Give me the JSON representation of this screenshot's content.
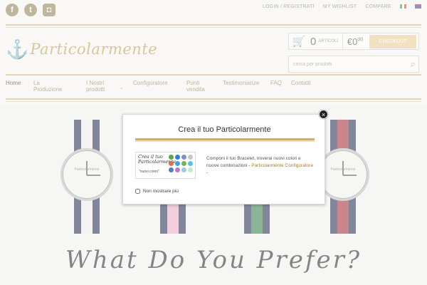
{
  "topbar": {
    "social": [
      {
        "name": "facebook-icon",
        "glyph": "f"
      },
      {
        "name": "tumblr-icon",
        "glyph": "t"
      },
      {
        "name": "instagram-icon",
        "glyph": "◘"
      }
    ],
    "links": [
      "LOGIN / REGISTRATI",
      "MY WISHLIST",
      "COMPARE"
    ],
    "languages": [
      "italian-flag-icon",
      "english-flag-icon"
    ]
  },
  "logo": {
    "text": "Particolarmente",
    "icon": "anchor-icon"
  },
  "cart": {
    "icon": "cart-icon",
    "count": "0",
    "count_label": "ARTICOLI",
    "price_currency": "€",
    "price_int": "0",
    "price_dec": "00",
    "checkout_label": "CHECKOUT"
  },
  "search": {
    "placeholder": "cerca per prodotti",
    "icon": "search-icon"
  },
  "nav": {
    "items": [
      {
        "label": "Home",
        "active": true
      },
      {
        "label": "La Produzione"
      },
      {
        "label": "I Nostri prodotti",
        "has_dropdown": true
      },
      {
        "label": "Configuratore"
      },
      {
        "label": "Punti vendita"
      },
      {
        "label": "Testimonianze"
      },
      {
        "label": "FAQ"
      },
      {
        "label": "Contatti"
      }
    ]
  },
  "main": {
    "tagline": "What Do You Prefer?",
    "watches": [
      {
        "brand": "Particolarmente",
        "strap_colors": [
          "#1c2347",
          "#e9e9e9",
          "#1c2347"
        ]
      },
      {
        "brand": "Particolarmente",
        "strap_colors": [
          "#1c2347",
          "#e7a7c0",
          "#1c2347"
        ]
      },
      {
        "brand": "Particolarmente",
        "strap_colors": [
          "#1c2347",
          "#2b7a3e",
          "#1c2347"
        ]
      },
      {
        "brand": "Particolarmente",
        "strap_colors": [
          "#1c2347",
          "#a1242c",
          "#1c2347"
        ]
      }
    ]
  },
  "modal": {
    "title": "Crea il tuo Particolarmente",
    "thumb_title": "Crea il tuo Particolarmente",
    "thumb_subtitle": "\"nuovi colori\"",
    "body_text": "Componi il tuo Bracelet, troverai nuovi colori e nuove combinazioni - ",
    "link_text": "Particolarmente Configuratore",
    "body_suffix": " -",
    "checkbox_label": "Non mostrare più",
    "close_glyph": "×",
    "swatches": [
      "#5aa64d",
      "#3a7bd5",
      "#7e8fc7",
      "#c6c6c6",
      "#e26f4b",
      "#45a0e0",
      "#77b255",
      "#5bc0de",
      "#4f7cc8",
      "#b57bc9",
      "#9bc9e0",
      "#c8e6c9"
    ]
  },
  "colors": {
    "accent_gold": "#c9b27a",
    "link_orange": "#b07a22",
    "checkout_bg": "#e6c98c"
  }
}
